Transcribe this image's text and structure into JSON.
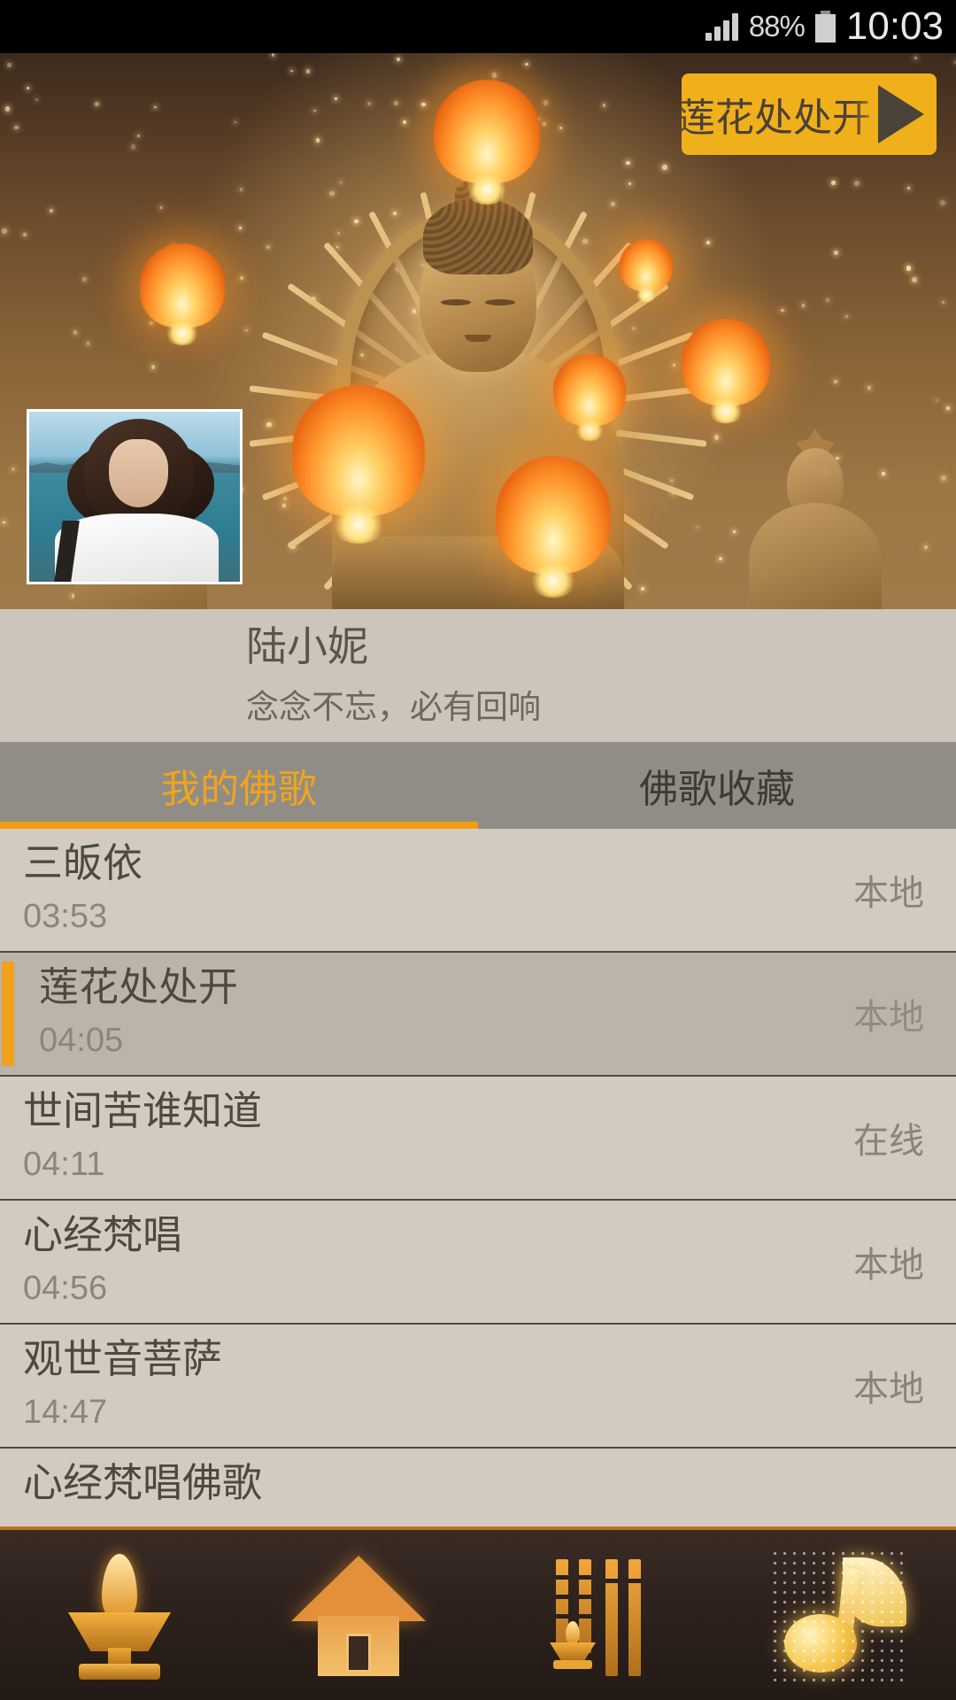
{
  "status_bar": {
    "battery_percent": "88%",
    "time": "10:03",
    "signal_icon": "signal-bars-icon",
    "battery_icon": "battery-icon"
  },
  "hero": {
    "now_playing_button": {
      "title": "莲花处处开",
      "play_icon": "play-triangle-icon"
    },
    "image_description": "golden-buddha-with-sky-lanterns"
  },
  "profile": {
    "avatar_alt": "user-avatar-photo",
    "name": "陆小妮",
    "motto": "念念不忘，必有回响"
  },
  "tabs": {
    "items": [
      {
        "label": "我的佛歌",
        "active": true
      },
      {
        "label": "佛歌收藏",
        "active": false
      }
    ],
    "active_color": "#f0a41e",
    "inactive_color": "#3f3a33",
    "bar_color": "#908d86",
    "underline_color": "#f09d12"
  },
  "song_list": {
    "rows": [
      {
        "title": "三皈依",
        "duration": "03:53",
        "source": "本地",
        "selected": false
      },
      {
        "title": "莲花处处开",
        "duration": "04:05",
        "source": "本地",
        "selected": true
      },
      {
        "title": "世间苦谁知道",
        "duration": "04:11",
        "source": "在线",
        "selected": false
      },
      {
        "title": "心经梵唱",
        "duration": "04:56",
        "source": "本地",
        "selected": false
      },
      {
        "title": "观世音菩萨",
        "duration": "14:47",
        "source": "本地",
        "selected": false
      },
      {
        "title": "心经梵唱佛歌",
        "duration": "",
        "source": "",
        "selected": false
      }
    ],
    "selected_bar_color": "#f0a21d",
    "selected_row_bg": "#bdb4a9",
    "row_bg": "#d3cbc1"
  },
  "bottom_nav": {
    "items": [
      {
        "icon": "oil-lamp-icon",
        "active": false
      },
      {
        "icon": "temple-house-icon",
        "active": false
      },
      {
        "icon": "incense-sticks-icon",
        "active": false
      },
      {
        "icon": "music-note-icon",
        "active": true
      }
    ],
    "background_color": "#2b201b",
    "accent_color": "#e8a534"
  }
}
